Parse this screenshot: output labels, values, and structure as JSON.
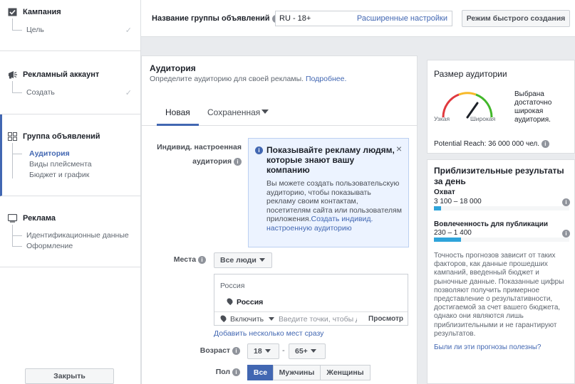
{
  "sidebar": {
    "campaign": {
      "title": "Кампания",
      "sub": "Цель"
    },
    "account": {
      "title": "Рекламный аккаунт",
      "sub": "Создать"
    },
    "adset": {
      "title": "Группа объявлений",
      "items": [
        "Аудитория",
        "Виды плейсмента",
        "Бюджет и график"
      ]
    },
    "ad": {
      "title": "Реклама",
      "items": [
        "Идентификационные данные",
        "Оформление"
      ]
    },
    "close_label": "Закрыть",
    "check_icon": "✓"
  },
  "topbar": {
    "name_label": "Название группы объявлений",
    "name_value": "RU - 18+",
    "advanced_link": "Расширенные настройки",
    "quick_mode": "Режим быстрого создания"
  },
  "audience": {
    "title": "Аудитория",
    "subtitle": "Определите аудиторию для своей рекламы.",
    "more_link": "Подробнее.",
    "tabs": [
      "Новая",
      "Сохраненная"
    ],
    "custom_label_line1": "Индивид. настроенная",
    "custom_label_line2": "аудитория",
    "tip": {
      "title": "Показывайте рекламу людям, которые знают вашу компанию",
      "body": "Вы можете создать пользовательскую аудиторию, чтобы показывать рекламу своим контактам, посетителям сайта или пользователям приложения.",
      "link": "Создать индивид. настроенную аудиторию",
      "close": "×"
    },
    "places_label": "Места",
    "places_select": "Все люди",
    "location_header": "Россия",
    "location_item": "Россия",
    "include_select": "Включить",
    "location_placeholder": "Введите точки, чтобы добавить",
    "view_label": "Просмотр",
    "add_multiple": "Добавить несколько мест сразу",
    "age_label": "Возраст",
    "age_from": "18",
    "age_sep": "-",
    "age_to": "65+",
    "gender_label": "Пол",
    "gender_options": [
      "Все",
      "Мужчины",
      "Женщины"
    ]
  },
  "audience_size": {
    "title": "Размер аудитории",
    "narrow": "Узкая",
    "wide": "Широкая",
    "description": "Выбрана достаточно широкая аудитория.",
    "potential_reach": "Potential Reach: 36 000 000 чел."
  },
  "estimates": {
    "title": "Приблизительные результаты за день",
    "reach_label": "Охват",
    "reach_value": "3 100 – 18 000",
    "reach_fraction": 0.05,
    "engagement_label": "Вовлеченность для публикации",
    "engagement_value": "230 – 1 400",
    "engagement_fraction": 0.2,
    "note": "Точность прогнозов зависит от таких факторов, как данные прошедших кампаний, введенный бюджет и рыночные данные. Показанные цифры позволяют получить примерное представление о результативности, достигаемой за счет вашего бюджета, однако они являются лишь приблизительными и не гарантируют результатов.",
    "feedback_link": "Были ли эти прогнозы полезны?"
  },
  "colors": {
    "accent": "#4267b2",
    "bar": "#2fa4da",
    "gauge_red": "#e0393e",
    "gauge_yellow": "#f7b928",
    "gauge_green": "#42b72a"
  }
}
